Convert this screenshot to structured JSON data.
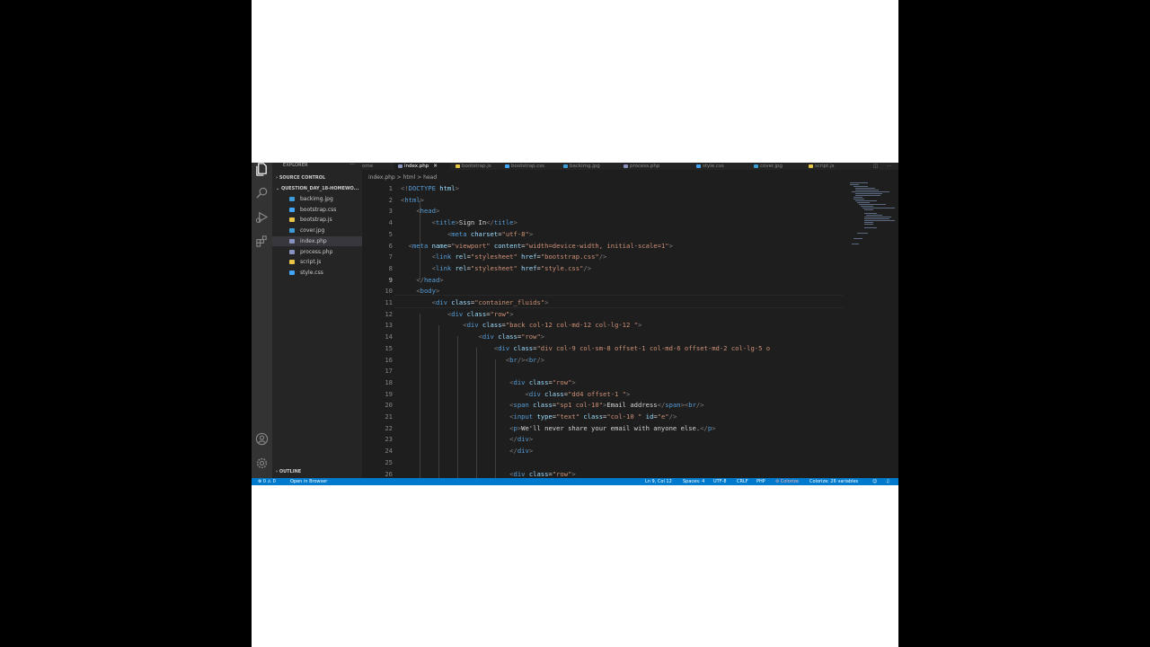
{
  "sidebar": {
    "title": "EXPLORER",
    "more": "···",
    "source_control": "SOURCE CONTROL",
    "folder": "QUESTION_DAY_18-HOMEWO...",
    "outline": "OUTLINE",
    "files": [
      {
        "name": "backimg.jpg",
        "icon_color": "#3c9bd6"
      },
      {
        "name": "bootstrap.css",
        "icon_color": "#42a5f5"
      },
      {
        "name": "bootstrap.js",
        "icon_color": "#e8c547"
      },
      {
        "name": "cover.jpg",
        "icon_color": "#3c9bd6"
      },
      {
        "name": "index.php",
        "icon_color": "#8892bf"
      },
      {
        "name": "process.php",
        "icon_color": "#8892bf"
      },
      {
        "name": "script.js",
        "icon_color": "#e8c547"
      },
      {
        "name": "style.css",
        "icon_color": "#42a5f5"
      }
    ],
    "active_file": "index.php"
  },
  "tabs": [
    {
      "label": "ome",
      "icon_color": "#519aba"
    },
    {
      "label": "index.php",
      "icon_color": "#8892bf",
      "close": "✕"
    },
    {
      "label": "bootstrap.js",
      "icon_color": "#e8c547"
    },
    {
      "label": "bootstrap.css",
      "icon_color": "#42a5f5"
    },
    {
      "label": "backimg.jpg",
      "icon_color": "#3c9bd6"
    },
    {
      "label": "process.php",
      "icon_color": "#8892bf"
    },
    {
      "label": "style.css",
      "icon_color": "#42a5f5"
    },
    {
      "label": "cover.jpg",
      "icon_color": "#3c9bd6"
    },
    {
      "label": "script.js",
      "icon_color": "#e8c547"
    }
  ],
  "breadcrumb": {
    "file": "index.php",
    "html": "html",
    "head": "head",
    "sep": ">"
  },
  "editor": {
    "current_line": 9,
    "line_numbers": [
      "1",
      "2",
      "3",
      "4",
      "5",
      "6",
      "7",
      "8",
      "9",
      "10",
      "11",
      "12",
      "13",
      "14",
      "15",
      "16",
      "17",
      "18",
      "19",
      "20",
      "21",
      "22",
      "23",
      "24",
      "25",
      "26"
    ]
  },
  "code": [
    [
      [
        "br",
        "<!"
      ],
      [
        "tg",
        "DOCTYPE"
      ],
      [
        "tx",
        " "
      ],
      [
        "at",
        "html"
      ],
      [
        "br",
        ">"
      ]
    ],
    [
      [
        "br",
        "<"
      ],
      [
        "tg",
        "html"
      ],
      [
        "br",
        ">"
      ]
    ],
    [
      [
        "tx",
        "    "
      ],
      [
        "br",
        "<"
      ],
      [
        "tg",
        "head"
      ],
      [
        "br",
        ">"
      ]
    ],
    [
      [
        "tx",
        "        "
      ],
      [
        "br",
        "<"
      ],
      [
        "tg",
        "title"
      ],
      [
        "br",
        ">"
      ],
      [
        "tx",
        "Sign In"
      ],
      [
        "br",
        "</"
      ],
      [
        "tg",
        "title"
      ],
      [
        "br",
        ">"
      ]
    ],
    [
      [
        "tx",
        "            "
      ],
      [
        "br",
        "<"
      ],
      [
        "tg",
        "meta"
      ],
      [
        "tx",
        " "
      ],
      [
        "at",
        "charset"
      ],
      [
        "tx",
        "="
      ],
      [
        "sv",
        "\"utf-8\""
      ],
      [
        "br",
        ">"
      ]
    ],
    [
      [
        "tx",
        "  "
      ],
      [
        "br",
        "<"
      ],
      [
        "tg",
        "meta"
      ],
      [
        "tx",
        " "
      ],
      [
        "at",
        "name"
      ],
      [
        "tx",
        "="
      ],
      [
        "sv",
        "\"viewport\""
      ],
      [
        "tx",
        " "
      ],
      [
        "at",
        "content"
      ],
      [
        "tx",
        "="
      ],
      [
        "sv",
        "\"width=device-width, initial-scale=1\""
      ],
      [
        "br",
        ">"
      ]
    ],
    [
      [
        "tx",
        "        "
      ],
      [
        "br",
        "<"
      ],
      [
        "tg",
        "link"
      ],
      [
        "tx",
        " "
      ],
      [
        "at",
        "rel"
      ],
      [
        "tx",
        "="
      ],
      [
        "sv",
        "\"stylesheet\""
      ],
      [
        "tx",
        " "
      ],
      [
        "at",
        "href"
      ],
      [
        "tx",
        "="
      ],
      [
        "sv",
        "\"bootstrap.css\""
      ],
      [
        "br",
        "/>"
      ]
    ],
    [
      [
        "tx",
        "        "
      ],
      [
        "br",
        "<"
      ],
      [
        "tg",
        "link"
      ],
      [
        "tx",
        " "
      ],
      [
        "at",
        "rel"
      ],
      [
        "tx",
        "="
      ],
      [
        "sv",
        "\"stylesheet\""
      ],
      [
        "tx",
        " "
      ],
      [
        "at",
        "href"
      ],
      [
        "tx",
        "="
      ],
      [
        "sv",
        "\"style.css\""
      ],
      [
        "br",
        "/>"
      ]
    ],
    [
      [
        "tx",
        "    "
      ],
      [
        "br",
        "</"
      ],
      [
        "tg",
        "head"
      ],
      [
        "br",
        ">"
      ]
    ],
    [
      [
        "tx",
        "    "
      ],
      [
        "br",
        "<"
      ],
      [
        "tg",
        "body"
      ],
      [
        "br",
        ">"
      ]
    ],
    [
      [
        "tx",
        "        "
      ],
      [
        "br",
        "<"
      ],
      [
        "tg",
        "div"
      ],
      [
        "tx",
        " "
      ],
      [
        "at",
        "class"
      ],
      [
        "tx",
        "="
      ],
      [
        "sv",
        "\"container_fluids\""
      ],
      [
        "br",
        ">"
      ]
    ],
    [
      [
        "tx",
        "            "
      ],
      [
        "br",
        "<"
      ],
      [
        "tg",
        "div"
      ],
      [
        "tx",
        " "
      ],
      [
        "at",
        "class"
      ],
      [
        "tx",
        "="
      ],
      [
        "sv",
        "\"row\""
      ],
      [
        "br",
        ">"
      ]
    ],
    [
      [
        "tx",
        "                "
      ],
      [
        "br",
        "<"
      ],
      [
        "tg",
        "div"
      ],
      [
        "tx",
        " "
      ],
      [
        "at",
        "class"
      ],
      [
        "tx",
        "="
      ],
      [
        "sv",
        "\"back col-12 col-md-12 col-lg-12 \""
      ],
      [
        "br",
        ">"
      ]
    ],
    [
      [
        "tx",
        "                    "
      ],
      [
        "br",
        "<"
      ],
      [
        "tg",
        "div"
      ],
      [
        "tx",
        " "
      ],
      [
        "at",
        "class"
      ],
      [
        "tx",
        "="
      ],
      [
        "sv",
        "\"row\""
      ],
      [
        "br",
        ">"
      ]
    ],
    [
      [
        "tx",
        "                        "
      ],
      [
        "br",
        "<"
      ],
      [
        "tg",
        "div"
      ],
      [
        "tx",
        " "
      ],
      [
        "at",
        "class"
      ],
      [
        "tx",
        "="
      ],
      [
        "sv",
        "\"div col-9 col-sm-8 offset-1 col-md-6 offset-md-2 col-lg-5 o"
      ]
    ],
    [
      [
        "tx",
        "                           "
      ],
      [
        "br",
        "<"
      ],
      [
        "tg",
        "br"
      ],
      [
        "br",
        "/><"
      ],
      [
        "tg",
        "br"
      ],
      [
        "br",
        "/>"
      ]
    ],
    [],
    [
      [
        "tx",
        "                            "
      ],
      [
        "br",
        "<"
      ],
      [
        "tg",
        "div"
      ],
      [
        "tx",
        " "
      ],
      [
        "at",
        "class"
      ],
      [
        "tx",
        "="
      ],
      [
        "sv",
        "\"row\""
      ],
      [
        "br",
        ">"
      ]
    ],
    [
      [
        "tx",
        "                                "
      ],
      [
        "br",
        "<"
      ],
      [
        "tg",
        "div"
      ],
      [
        "tx",
        " "
      ],
      [
        "at",
        "class"
      ],
      [
        "tx",
        "="
      ],
      [
        "sv",
        "\"dd4 offset-1 \""
      ],
      [
        "br",
        ">"
      ]
    ],
    [
      [
        "tx",
        "                            "
      ],
      [
        "br",
        "<"
      ],
      [
        "tg",
        "span"
      ],
      [
        "tx",
        " "
      ],
      [
        "at",
        "class"
      ],
      [
        "tx",
        "="
      ],
      [
        "sv",
        "\"sp1 col-10\""
      ],
      [
        "br",
        ">"
      ],
      [
        "tx",
        "Email address"
      ],
      [
        "br",
        "</"
      ],
      [
        "tg",
        "span"
      ],
      [
        "br",
        "><"
      ],
      [
        "tg",
        "br"
      ],
      [
        "br",
        "/>"
      ]
    ],
    [
      [
        "tx",
        "                            "
      ],
      [
        "br",
        "<"
      ],
      [
        "tg",
        "input"
      ],
      [
        "tx",
        " "
      ],
      [
        "at",
        "type"
      ],
      [
        "tx",
        "="
      ],
      [
        "sv",
        "\"text\""
      ],
      [
        "tx",
        " "
      ],
      [
        "at",
        "class"
      ],
      [
        "tx",
        "="
      ],
      [
        "sv",
        "\"col-10 \""
      ],
      [
        "tx",
        " "
      ],
      [
        "at",
        "id"
      ],
      [
        "tx",
        "="
      ],
      [
        "sv",
        "\"e\""
      ],
      [
        "br",
        "/>"
      ]
    ],
    [
      [
        "tx",
        "                            "
      ],
      [
        "br",
        "<"
      ],
      [
        "tg",
        "p"
      ],
      [
        "br",
        ">"
      ],
      [
        "tx",
        "We'll never share your email with anyone else."
      ],
      [
        "br",
        "</"
      ],
      [
        "tg",
        "p"
      ],
      [
        "br",
        ">"
      ]
    ],
    [
      [
        "tx",
        "                            "
      ],
      [
        "br",
        "</"
      ],
      [
        "tg",
        "div"
      ],
      [
        "br",
        ">"
      ]
    ],
    [
      [
        "tx",
        "                            "
      ],
      [
        "br",
        "</"
      ],
      [
        "tg",
        "div"
      ],
      [
        "br",
        ">"
      ]
    ],
    [],
    [
      [
        "tx",
        "                            "
      ],
      [
        "br",
        "<"
      ],
      [
        "tg",
        "div"
      ],
      [
        "tx",
        " "
      ],
      [
        "at",
        "class"
      ],
      [
        "tx",
        "="
      ],
      [
        "sv",
        "\"row\""
      ],
      [
        "br",
        ">"
      ]
    ]
  ],
  "statusbar": {
    "problems": "⊗ 0 ⚠ 0",
    "open_in_browser": "Open in Browser",
    "position": "Ln 9, Col 12",
    "spaces": "Spaces: 4",
    "encoding": "UTF-8",
    "eol": "CRLF",
    "language": "PHP",
    "colorize": "⊘ Colorize",
    "colorize_vars": "Colorize: 26 variables"
  },
  "colors": {
    "statusbar": "#007acc",
    "editor_bg": "#1e1e1e",
    "sidebar_bg": "#252526",
    "activity_bg": "#333333"
  }
}
